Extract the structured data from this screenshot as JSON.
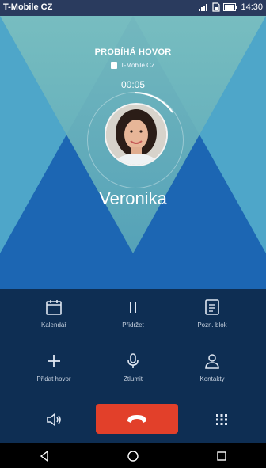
{
  "status_bar": {
    "carrier": "T-Mobile CZ",
    "time": "14:30"
  },
  "call": {
    "state_label": "PROBÍHÁ HOVOR",
    "network_label": "T-Mobile CZ",
    "timer": "00:05",
    "contact_name": "Veronika"
  },
  "controls": {
    "calendar_label": "Kalendář",
    "hold_label": "Přidržet",
    "note_label": "Pozn. blok",
    "add_call_label": "Přidat hovor",
    "mute_label": "Ztlumit",
    "contacts_label": "Kontakty"
  },
  "colors": {
    "end_call": "#e2402a",
    "background": "#1c66b3",
    "controls_bg": "#0e2e53"
  }
}
